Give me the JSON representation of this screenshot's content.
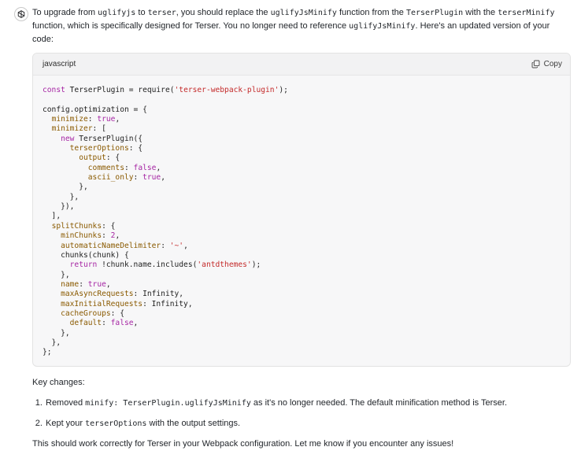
{
  "message": {
    "intro": {
      "t1": "To upgrade from ",
      "c1": "uglifyjs",
      "t2": " to ",
      "c2": "terser",
      "t3": ", you should replace the ",
      "c3": "uglifyJsMinify",
      "t4": " function from the ",
      "c4": "TerserPlugin",
      "t5": " with the ",
      "c5": "terserMinify",
      "t6": " function, which is specifically designed for Terser. You no longer need to reference ",
      "c6": "uglifyJsMinify",
      "t7": ". Here's an updated version of your code:"
    },
    "code_block": {
      "language": "javascript",
      "copy_label": "Copy",
      "lines": [
        [
          [
            "const ",
            "k"
          ],
          [
            "TerserPlugin = require(",
            ""
          ],
          [
            "'terser-webpack-plugin'",
            "s"
          ],
          [
            ");",
            ""
          ]
        ],
        [],
        [
          [
            "config.optimization = {",
            ""
          ]
        ],
        [
          [
            "  ",
            ""
          ],
          [
            "minimize",
            "p"
          ],
          [
            ": ",
            ""
          ],
          [
            "true",
            "b"
          ],
          [
            ",",
            ""
          ]
        ],
        [
          [
            "  ",
            ""
          ],
          [
            "minimizer",
            "p"
          ],
          [
            ": [",
            ""
          ]
        ],
        [
          [
            "    ",
            ""
          ],
          [
            "new ",
            "k"
          ],
          [
            "TerserPlugin({",
            ""
          ]
        ],
        [
          [
            "      ",
            ""
          ],
          [
            "terserOptions",
            "p"
          ],
          [
            ": {",
            ""
          ]
        ],
        [
          [
            "        ",
            ""
          ],
          [
            "output",
            "p"
          ],
          [
            ": {",
            ""
          ]
        ],
        [
          [
            "          ",
            ""
          ],
          [
            "comments",
            "p"
          ],
          [
            ": ",
            ""
          ],
          [
            "false",
            "b"
          ],
          [
            ",",
            ""
          ]
        ],
        [
          [
            "          ",
            ""
          ],
          [
            "ascii_only",
            "p"
          ],
          [
            ": ",
            ""
          ],
          [
            "true",
            "b"
          ],
          [
            ",",
            ""
          ]
        ],
        [
          [
            "        },",
            ""
          ]
        ],
        [
          [
            "      },",
            ""
          ]
        ],
        [
          [
            "    }),",
            ""
          ]
        ],
        [
          [
            "  ],",
            ""
          ]
        ],
        [
          [
            "  ",
            ""
          ],
          [
            "splitChunks",
            "p"
          ],
          [
            ": {",
            ""
          ]
        ],
        [
          [
            "    ",
            ""
          ],
          [
            "minChunks",
            "p"
          ],
          [
            ": ",
            ""
          ],
          [
            "2",
            "b"
          ],
          [
            ",",
            ""
          ]
        ],
        [
          [
            "    ",
            ""
          ],
          [
            "automaticNameDelimiter",
            "p"
          ],
          [
            ": ",
            ""
          ],
          [
            "'~'",
            "s"
          ],
          [
            ",",
            ""
          ]
        ],
        [
          [
            "    chunks(chunk) {",
            ""
          ]
        ],
        [
          [
            "      ",
            ""
          ],
          [
            "return ",
            "k"
          ],
          [
            "!chunk.name.includes(",
            ""
          ],
          [
            "'antdthemes'",
            "s"
          ],
          [
            ");",
            ""
          ]
        ],
        [
          [
            "    },",
            ""
          ]
        ],
        [
          [
            "    ",
            ""
          ],
          [
            "name",
            "p"
          ],
          [
            ": ",
            ""
          ],
          [
            "true",
            "b"
          ],
          [
            ",",
            ""
          ]
        ],
        [
          [
            "    ",
            ""
          ],
          [
            "maxAsyncRequests",
            "p"
          ],
          [
            ": Infinity,",
            ""
          ]
        ],
        [
          [
            "    ",
            ""
          ],
          [
            "maxInitialRequests",
            "p"
          ],
          [
            ": Infinity,",
            ""
          ]
        ],
        [
          [
            "    ",
            ""
          ],
          [
            "cacheGroups",
            "p"
          ],
          [
            ": {",
            ""
          ]
        ],
        [
          [
            "      ",
            ""
          ],
          [
            "default",
            "p"
          ],
          [
            ": ",
            ""
          ],
          [
            "false",
            "b"
          ],
          [
            ",",
            ""
          ]
        ],
        [
          [
            "    },",
            ""
          ]
        ],
        [
          [
            "  },",
            ""
          ]
        ],
        [
          [
            "};",
            ""
          ]
        ]
      ]
    },
    "key_changes_heading": "Key changes:",
    "changes": [
      {
        "t1": "Removed ",
        "c1": "minify: TerserPlugin.uglifyJsMinify",
        "t2": " as it's no longer needed. The default minification method is Terser."
      },
      {
        "t1": "Kept your ",
        "c1": "terserOptions",
        "t2": " with the output settings."
      }
    ],
    "closing": "This should work correctly for Terser in your Webpack configuration. Let me know if you encounter any issues!"
  },
  "icons": {
    "avatar": "openai-logo-icon",
    "copy": "copy-icon"
  }
}
